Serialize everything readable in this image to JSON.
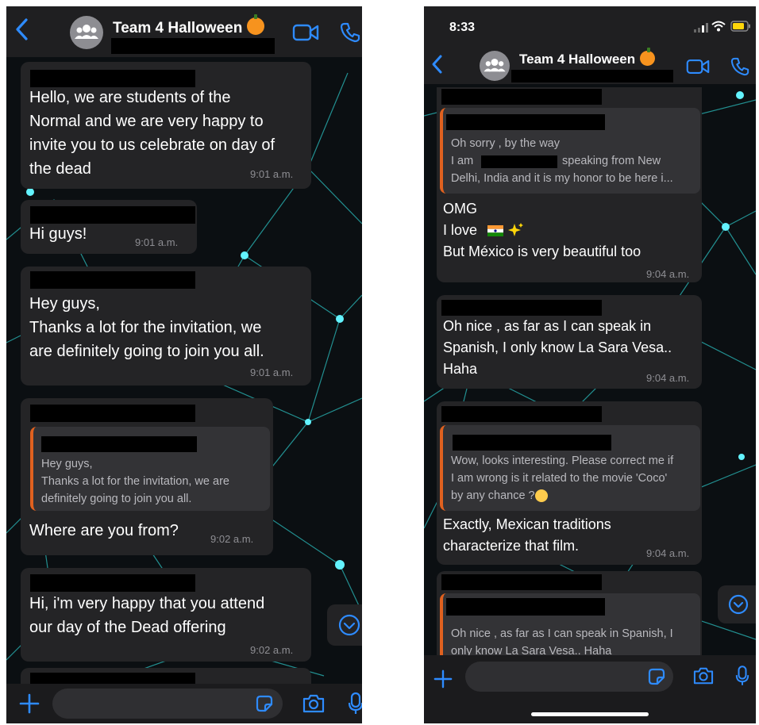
{
  "left": {
    "header": {
      "title": "Team 4 Halloween"
    },
    "messages": [
      {
        "text": "Hello, we are students of the\nNormal and we are very happy to\ninvite you to us celebrate on day of\nthe dead",
        "time": "9:01 a.m."
      },
      {
        "text": "Hi guys!",
        "time": "9:01 a.m."
      },
      {
        "text": "Hey guys,\nThanks a lot for the invitation, we\nare definitely going to join you all.",
        "time": "9:01 a.m."
      },
      {
        "quote": "Hey guys,\nThanks a lot for the invitation, we are\ndefinitely going to join you all.",
        "text": "Where are you from?",
        "time": "9:02 a.m."
      },
      {
        "text": "Hi, i'm very happy that you  attend\nour day  of the Dead offering",
        "time": "9:02 a.m."
      }
    ]
  },
  "right": {
    "status": {
      "time": "8:33"
    },
    "header": {
      "title": "Team 4 Halloween"
    },
    "messages": [
      {
        "quote_a": "Oh sorry , by the way",
        "quote_b": "I am ",
        "quote_c": "speaking from New",
        "quote_d": "Delhi, India and it is my honor to be here i...",
        "text": "OMG\nI love \nBut México is very beautiful too",
        "time": "9:04 a.m."
      },
      {
        "text": "Oh nice , as far as I can speak in\nSpanish, I only know  La Sara Vesa..\nHaha",
        "time": "9:04 a.m."
      },
      {
        "quote": "Wow, looks interesting. Please correct me if\nI am wrong is it related to the movie 'Coco'\nby any chance  ?",
        "text": "Exactly, Mexican traditions\ncharacterize that film.",
        "time": "9:04 a.m."
      },
      {
        "quote": "Oh nice , as far as I can speak in Spanish, I\nonly know  La Sara Vesa.. Haha"
      }
    ]
  },
  "icons": {
    "back": "chevron-left-icon",
    "video": "video-camera-icon",
    "call": "phone-icon",
    "attach": "plus-icon",
    "sticker": "sticker-icon",
    "camera": "camera-icon",
    "mic": "microphone-icon",
    "scroll_down": "chevron-down-circle-icon"
  },
  "colors": {
    "accent": "#2e8bff",
    "bubble": "#242426",
    "quote_bar": "#e0611f",
    "background": "#0b0f12"
  }
}
